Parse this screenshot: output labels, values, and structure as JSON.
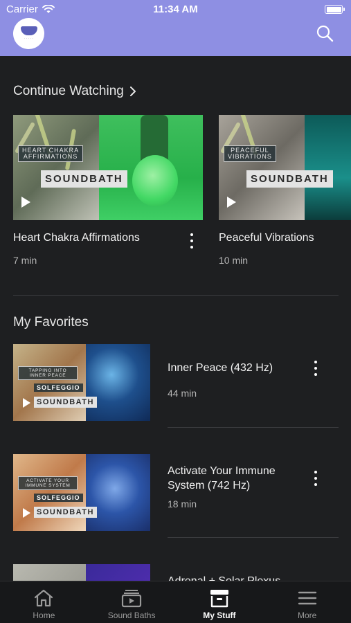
{
  "status_bar": {
    "carrier": "Carrier",
    "time": "11:34 AM"
  },
  "header": {
    "logo_icon": "soundbath-bowl-logo",
    "search_icon": "search-icon",
    "accent_color": "#8e8fe3"
  },
  "continue_watching": {
    "title": "Continue Watching",
    "items": [
      {
        "title": "Heart Chakra Affirmations",
        "duration": "7 min",
        "tag": "HEART CHAKRA\nAFFIRMATIONS",
        "brand": "SOUNDBATH",
        "accent": "#2fcf5b"
      },
      {
        "title": "Peaceful Vibrations",
        "duration": "10 min",
        "tag": "PEACEFUL\nVIBRATIONS",
        "brand": "SOUNDBATH",
        "accent": "#1a8f8a"
      }
    ]
  },
  "favorites": {
    "title": "My Favorites",
    "items": [
      {
        "title": "Inner Peace (432 Hz)",
        "duration": "44 min",
        "tag": "TAPPING INTO\nINNER PEACE",
        "category": "SOLFEGGIO",
        "brand": "SOUNDBATH"
      },
      {
        "title": "Activate Your Immune System (742 Hz)",
        "duration": "18 min",
        "tag": "ACTIVATE YOUR\nIMMUNE SYSTEM",
        "category": "SOLFEGGIO",
        "brand": "SOUNDBATH"
      },
      {
        "title": "Adrenal + Solar Plexus"
      }
    ]
  },
  "tab_bar": {
    "tabs": [
      {
        "label": "Home",
        "icon": "home-icon",
        "active": false
      },
      {
        "label": "Sound Baths",
        "icon": "sound-baths-icon",
        "active": false
      },
      {
        "label": "My Stuff",
        "icon": "my-stuff-icon",
        "active": true
      },
      {
        "label": "More",
        "icon": "menu-icon",
        "active": false
      }
    ]
  }
}
